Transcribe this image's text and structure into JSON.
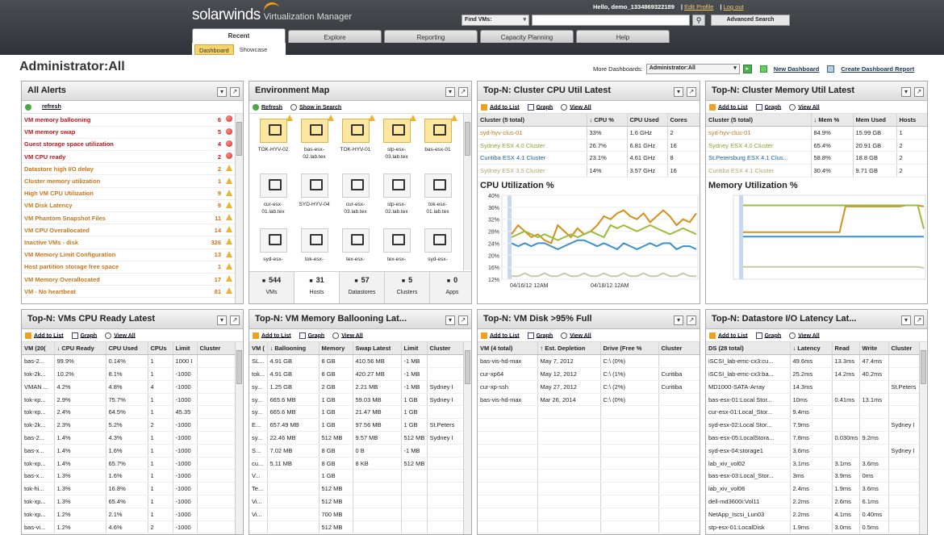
{
  "app": {
    "brand": "solarwinds",
    "product": "Virtualization Manager"
  },
  "user": {
    "greeting": "Hello, demo_1334869322189",
    "edit_profile": "Edit Profile",
    "logout": "Log out"
  },
  "find": {
    "select": "Find VMs:",
    "button": "Advanced Search"
  },
  "tabs": [
    "Recent",
    "Explore",
    "Reporting",
    "Capacity Planning",
    "Help"
  ],
  "subtabs": [
    "Dashboard",
    "Showcase"
  ],
  "page_title": "Administrator:All",
  "more": {
    "label": "More Dashboards:",
    "value": "Administrator:All",
    "new": "New Dashboard",
    "create": "Create Dashboard Report"
  },
  "alerts": {
    "title": "All Alerts",
    "refresh": "refresh",
    "items": [
      {
        "label": "VM memory ballooning",
        "count": "6",
        "sev": "red"
      },
      {
        "label": "VM memory swap",
        "count": "5",
        "sev": "red"
      },
      {
        "label": "Guest storage space utilization",
        "count": "4",
        "sev": "red"
      },
      {
        "label": "VM CPU ready",
        "count": "2",
        "sev": "red"
      },
      {
        "label": "Datastore high I/O delay",
        "count": "2",
        "sev": "warn"
      },
      {
        "label": "Cluster memory utilization",
        "count": "1",
        "sev": "warn"
      },
      {
        "label": "High VM CPU Utilization",
        "count": "9",
        "sev": "warn"
      },
      {
        "label": "VM Disk Latency",
        "count": "9",
        "sev": "warn"
      },
      {
        "label": "VM Phantom Snapshot Files",
        "count": "11",
        "sev": "warn"
      },
      {
        "label": "VM CPU Overallocated",
        "count": "14",
        "sev": "warn"
      },
      {
        "label": "Inactive VMs - disk",
        "count": "326",
        "sev": "warn"
      },
      {
        "label": "VM Memory Limit Configuration",
        "count": "13",
        "sev": "warn"
      },
      {
        "label": "Host partition storage free space",
        "count": "1",
        "sev": "warn"
      },
      {
        "label": "VM Memory Overallocated",
        "count": "17",
        "sev": "warn"
      },
      {
        "label": "VM - No heartbeat",
        "count": "81",
        "sev": "warn"
      }
    ]
  },
  "envmap": {
    "title": "Environment Map",
    "refresh": "Refresh",
    "show": "Show in Search",
    "hosts": [
      {
        "n": "TOK-HYV-02",
        "w": true
      },
      {
        "n": "bas-esx-02.lab.tex",
        "w": true
      },
      {
        "n": "TOK-HYV-01",
        "w": true
      },
      {
        "n": "stp-esx-03.lab.tex",
        "w": true
      },
      {
        "n": "bas-esx-01",
        "w": true
      },
      {
        "n": "cur-esx-01.lab.tex",
        "w": false
      },
      {
        "n": "SYD-HYV-04",
        "w": false
      },
      {
        "n": "cur-esx-03.lab.tex",
        "w": false
      },
      {
        "n": "stp-esx-02.lab.tex",
        "w": false
      },
      {
        "n": "tok-esx-01.lab.tex",
        "w": false
      },
      {
        "n": "syd-esx-",
        "w": false
      },
      {
        "n": "tok-esx-",
        "w": false
      },
      {
        "n": "tex-esx-",
        "w": false
      },
      {
        "n": "tex-esx-",
        "w": false
      },
      {
        "n": "syd-esx-",
        "w": false
      }
    ],
    "inventory": [
      {
        "c": "544",
        "l": "VMs"
      },
      {
        "c": "31",
        "l": "Hosts"
      },
      {
        "c": "57",
        "l": "Datastores"
      },
      {
        "c": "5",
        "l": "Clusters"
      },
      {
        "c": "0",
        "l": "Apps"
      }
    ]
  },
  "cpu": {
    "title": "Top-N: Cluster CPU Util Latest",
    "add": "Add to List",
    "graph": "Graph",
    "view": "View All",
    "headers": [
      "Cluster (5 total)",
      "↓ CPU %",
      "CPU Used",
      "Cores"
    ],
    "rows": [
      [
        "syd-hyv-clus-01",
        "33%",
        "1.6 GHz",
        "2",
        "org"
      ],
      [
        "Sydney ESX 4.0 Cluster",
        "26.7%",
        "6.81 GHz",
        "16",
        "grn"
      ],
      [
        "Curitiba ESX 4.1 Cluster",
        "23.1%",
        "4.61 GHz",
        "8",
        "blu"
      ],
      [
        "Sydney ESX 3.5 Cluster",
        "14%",
        "3.57 GHz",
        "16",
        "gry"
      ]
    ],
    "chart_title": "CPU Utilization %"
  },
  "mem": {
    "title": "Top-N: Cluster Memory Util Latest",
    "add": "Add to List",
    "graph": "Graph",
    "view": "View All",
    "headers": [
      "Cluster (5 total)",
      "↓ Mem %",
      "Mem Used",
      "Hosts"
    ],
    "rows": [
      [
        "syd-hyv-clus-01",
        "84.9%",
        "15.99 GB",
        "1",
        "org"
      ],
      [
        "Sydney ESX 4.0 Cluster",
        "65.4%",
        "20.91 GB",
        "2",
        "grn"
      ],
      [
        "St.Petersburg ESX 4.1 Clus...",
        "58.8%",
        "18.8 GB",
        "2",
        "blu"
      ],
      [
        "Curitiba ESX 4.1 Cluster",
        "30.4%",
        "9.71 GB",
        "2",
        "gry"
      ]
    ],
    "chart_title": "Memory Utilization %"
  },
  "chart_data": [
    {
      "type": "line",
      "title": "CPU Utilization %",
      "y_ticks": [
        "40%",
        "36%",
        "32%",
        "28%",
        "24%",
        "20%",
        "16%",
        "12%"
      ],
      "ylim": [
        12,
        40
      ],
      "x_ticks": [
        "04/16/12 12AM",
        "04/18/12 12AM"
      ],
      "series": [
        {
          "color": "#d4901a",
          "values": [
            27,
            30,
            28,
            26,
            27,
            25,
            24,
            30,
            28,
            26,
            29,
            27,
            28,
            30,
            33,
            32,
            34,
            35,
            33,
            32,
            34,
            31,
            33,
            35,
            33,
            30,
            32,
            31,
            34
          ]
        },
        {
          "color": "#9dbb3a",
          "values": [
            26,
            27,
            28,
            27,
            26,
            27,
            26,
            25,
            26,
            27,
            26,
            27,
            28,
            27,
            26,
            30,
            29,
            30,
            29,
            28,
            29,
            30,
            29,
            28,
            27,
            28,
            29,
            28,
            27
          ]
        },
        {
          "color": "#3a90cc",
          "values": [
            24,
            23,
            24,
            23,
            24,
            24,
            23,
            22,
            23,
            24,
            25,
            25,
            24,
            23,
            24,
            23,
            22,
            24,
            23,
            22,
            23,
            24,
            23,
            24,
            24,
            22,
            23,
            23,
            22
          ]
        },
        {
          "color": "#c8c8a8",
          "values": [
            13,
            13,
            14,
            13,
            13,
            14,
            13,
            13,
            14,
            13,
            13,
            14,
            13,
            13,
            14,
            13,
            13,
            14,
            13,
            13,
            14,
            13,
            13,
            14,
            13,
            13,
            14,
            13,
            13
          ]
        }
      ]
    },
    {
      "type": "line",
      "title": "Memory Utilization %",
      "series": [
        {
          "color": "#d4901a",
          "values": [
            62,
            62,
            62,
            62,
            62,
            62,
            62,
            62,
            62,
            62,
            62,
            62,
            62,
            62,
            62,
            62,
            62,
            85,
            85,
            85,
            85,
            85,
            85,
            85,
            85,
            85,
            85,
            86,
            86,
            86,
            85
          ]
        },
        {
          "color": "#9dbb3a",
          "values": [
            86,
            86,
            86,
            86,
            86,
            86,
            86,
            86,
            86,
            86,
            86,
            86,
            86,
            86,
            86,
            86,
            86,
            86,
            86,
            86,
            86,
            86,
            86,
            86,
            86,
            86,
            86,
            86,
            86,
            86,
            65
          ]
        },
        {
          "color": "#3a90cc",
          "values": [
            58,
            58,
            58,
            58,
            58,
            58,
            58,
            58,
            58,
            58,
            58,
            58,
            58,
            58,
            58,
            58,
            58,
            58,
            58,
            58,
            58,
            58,
            58,
            58,
            58,
            58,
            58,
            58,
            58,
            58,
            58
          ]
        },
        {
          "color": "#c8c8a8",
          "values": [
            31,
            31,
            31,
            31,
            31,
            31,
            31,
            31,
            31,
            31,
            31,
            31,
            31,
            31,
            31,
            31,
            31,
            31,
            31,
            31,
            31,
            31,
            31,
            31,
            31,
            31,
            31,
            31,
            31,
            31,
            30
          ]
        }
      ]
    }
  ],
  "vmcpu": {
    "title": "Top-N: VMs CPU Ready Latest",
    "add": "Add to List",
    "graph": "Graph",
    "view": "View All",
    "headers": [
      "VM (20(",
      "↓ CPU Ready",
      "CPU Used",
      "CPUs",
      "Limit",
      "Cluster"
    ],
    "rows": [
      [
        "bas-2...",
        "99.9%",
        "0.14%",
        "1",
        "1000 I",
        ""
      ],
      [
        "tok-2k...",
        "10.2%",
        "8.1%",
        "1",
        "-1000",
        ""
      ],
      [
        "VMAN ...",
        "4.2%",
        "4.8%",
        "4",
        "-1000",
        ""
      ],
      [
        "tok-xp...",
        "2.9%",
        "75.7%",
        "1",
        "-1000",
        ""
      ],
      [
        "tok-xp...",
        "2.4%",
        "64.5%",
        "1",
        "45.35",
        ""
      ],
      [
        "tok-2k...",
        "2.3%",
        "5.2%",
        "2",
        "-1000",
        ""
      ],
      [
        "bas-2...",
        "1.4%",
        "4.3%",
        "1",
        "-1000",
        ""
      ],
      [
        "bas-x...",
        "1.4%",
        "1.6%",
        "1",
        "-1000",
        ""
      ],
      [
        "tok-xp...",
        "1.4%",
        "65.7%",
        "1",
        "-1000",
        ""
      ],
      [
        "bas-x...",
        "1.3%",
        "1.6%",
        "1",
        "-1000",
        ""
      ],
      [
        "tok-hi...",
        "1.3%",
        "16.8%",
        "1",
        "-1000",
        ""
      ],
      [
        "tok-xp...",
        "1.3%",
        "65.4%",
        "1",
        "-1000",
        ""
      ],
      [
        "tok-xp...",
        "1.2%",
        "2.1%",
        "1",
        "-1000",
        ""
      ],
      [
        "bas-vi...",
        "1.2%",
        "4.6%",
        "2",
        "-1000",
        ""
      ]
    ]
  },
  "vmmem": {
    "title": "Top-N: VM Memory Ballooning Lat...",
    "add": "Add to List",
    "graph": "Graph",
    "view": "View All",
    "headers": [
      "VM (",
      "↓ Ballooning",
      "Memory",
      "Swap Latest",
      "Limit",
      "Cluster"
    ],
    "rows": [
      [
        "SL...",
        "4.91 GB",
        "8 GB",
        "410.56 MB",
        "-1 MB",
        ""
      ],
      [
        "tok...",
        "4.91 GB",
        "8 GB",
        "420.27 MB",
        "-1 MB",
        ""
      ],
      [
        "sy...",
        "1.25 GB",
        "2 GB",
        "2.21 MB",
        "-1 MB",
        "Sydney I"
      ],
      [
        "sy...",
        "665.6 MB",
        "1 GB",
        "59.03 MB",
        "1 GB",
        "Sydney I"
      ],
      [
        "sy...",
        "665.6 MB",
        "1 GB",
        "21.47 MB",
        "1 GB",
        ""
      ],
      [
        "E...",
        "657.49 MB",
        "1 GB",
        "97.56 MB",
        "1 GB",
        "St.Peters"
      ],
      [
        "sy...",
        "22.46 MB",
        "512 MB",
        "9.57 MB",
        "512 MB",
        "Sydney I"
      ],
      [
        "S...",
        "7.02 MB",
        "8 GB",
        "0 B",
        "-1 MB",
        ""
      ],
      [
        "cu...",
        "5.11 MB",
        "8 GB",
        "8 KB",
        "512 MB",
        ""
      ],
      [
        "V...",
        "",
        "1 GB",
        "",
        "",
        ""
      ],
      [
        "Te...",
        "",
        "512 MB",
        "",
        "",
        ""
      ],
      [
        "Vi...",
        "",
        "512 MB",
        "",
        "",
        ""
      ],
      [
        "Vi...",
        "",
        "700 MB",
        "",
        "",
        ""
      ],
      [
        "",
        "",
        "512 MB",
        "",
        "",
        ""
      ]
    ]
  },
  "disk": {
    "title": "Top-N: VM Disk >95% Full",
    "add": "Add to List",
    "graph": "Graph",
    "view": "View All",
    "headers": [
      "VM (4 total)",
      "↑ Est. Depletion",
      "Drive (Free %",
      "Cluster"
    ],
    "rows": [
      [
        "bas-vis-hd-max",
        "May 7, 2012",
        "C:\\ (0%)",
        ""
      ],
      [
        "cur-xp64",
        "May 12, 2012",
        "C:\\ (1%)",
        "Curitiba"
      ],
      [
        "cur-xp-ssh",
        "May 27, 2012",
        "C:\\ (2%)",
        "Curitiba"
      ],
      [
        "bas-vis-hd-max",
        "Mar 26, 2014",
        "C:\\ (0%)",
        ""
      ],
      [
        "",
        "",
        "",
        ""
      ],
      [
        "",
        "",
        "",
        ""
      ],
      [
        "",
        "",
        "",
        ""
      ],
      [
        "",
        "",
        "",
        ""
      ],
      [
        "",
        "",
        "",
        ""
      ],
      [
        "",
        "",
        "",
        ""
      ],
      [
        "",
        "",
        "",
        ""
      ],
      [
        "",
        "",
        "",
        ""
      ],
      [
        "",
        "",
        "",
        ""
      ],
      [
        "",
        "",
        "",
        ""
      ]
    ]
  },
  "ds": {
    "title": "Top-N: Datastore I/O Latency Lat...",
    "add": "Add to List",
    "graph": "Graph",
    "view": "View All",
    "headers": [
      "DS (28 total)",
      "↓ Latency",
      "Read",
      "Write",
      "Cluster"
    ],
    "rows": [
      [
        "iSCSI_lab-emc-cx3:cu...",
        "49.6ms",
        "13.3ms",
        "47.4ms",
        ""
      ],
      [
        "iSCSI_lab-emc-cx3:ba...",
        "25.2ms",
        "14.2ms",
        "40.2ms",
        ""
      ],
      [
        "MD1000-SATA-Array",
        "14.3ms",
        "",
        "",
        "St.Peters"
      ],
      [
        "bas-esx-01:Local Stor...",
        "10ms",
        "0.41ms",
        "13.1ms",
        ""
      ],
      [
        "cur-esx-01:Local_Stor...",
        "9.4ms",
        "",
        "",
        ""
      ],
      [
        "syd-esx-02:Local Stor...",
        "7.9ms",
        "",
        "",
        "Sydney I"
      ],
      [
        "bas-esx-05:LocalStora...",
        "7.8ms",
        "0.030ms",
        "9.2ms",
        ""
      ],
      [
        "syd-esx-04:storage1",
        "3.6ms",
        "",
        "",
        "Sydney I"
      ],
      [
        "lab_xiv_vol02",
        "3.1ms",
        "3.1ms",
        "3.6ms",
        ""
      ],
      [
        "bas-esx-03:Local_Stor...",
        "3ms",
        "3.9ms",
        "0ms",
        ""
      ],
      [
        "lab_xiv_vol06",
        "2.4ms",
        "1.9ms",
        "3.6ms",
        ""
      ],
      [
        "dell-md3600i:Vol11",
        "2.2ms",
        "2.6ms",
        "6.1ms",
        ""
      ],
      [
        "NetApp_Iscsi_Lun03",
        "2.2ms",
        "4.1ms",
        "0.40ms",
        ""
      ],
      [
        "stp-esx-01:LocalDisk",
        "1.9ms",
        "3.0ms",
        "0.5ms",
        ""
      ]
    ]
  }
}
